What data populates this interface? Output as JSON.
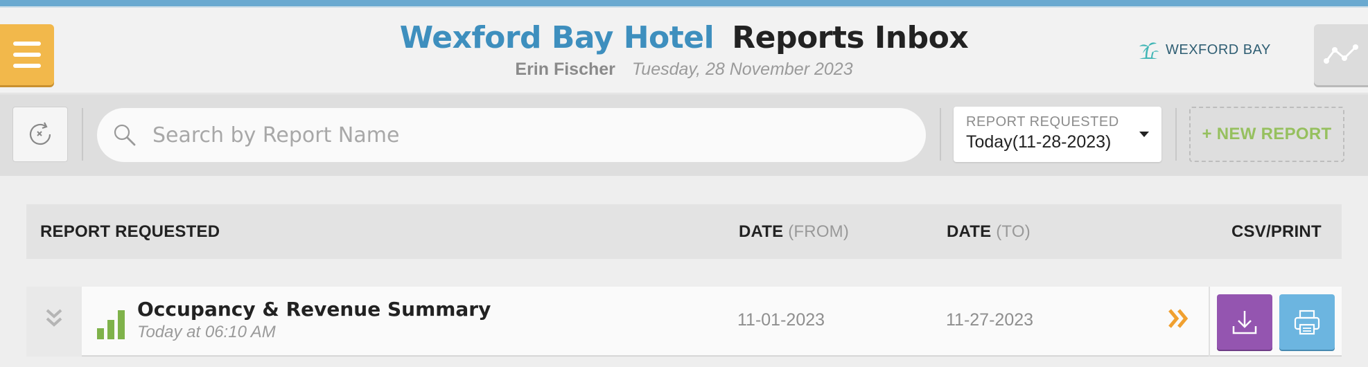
{
  "header": {
    "hotel_name": "Wexford Bay Hotel",
    "page_title": "Reports Inbox",
    "user_name": "Erin Fischer",
    "date": "Tuesday, 28 November 2023",
    "brand_text": "WEXFORD BAY",
    "brand_icon": "palm-island-icon",
    "menu_icon": "hamburger-menu-icon",
    "graph_icon": "line-graph-icon"
  },
  "toolbar": {
    "reset_icon": "reset-filters-icon",
    "search_placeholder": "Search by Report Name",
    "search_value": "",
    "filter_label": "REPORT REQUESTED",
    "filter_value": "Today(11-28-2023)",
    "new_report_label": "+ NEW REPORT"
  },
  "table": {
    "columns": {
      "report": "REPORT REQUESTED",
      "date_from_main": "DATE",
      "date_from_qual": "(FROM)",
      "date_to_main": "DATE",
      "date_to_qual": "(TO)",
      "actions": "CSV/PRINT"
    },
    "rows": [
      {
        "name": "Occupancy & Revenue Summary",
        "requested": "Today at 06:10 AM",
        "date_from": "11-01-2023",
        "date_to": "11-27-2023",
        "type_icon": "bar-chart-icon"
      }
    ]
  },
  "colors": {
    "accent_blue": "#3e8fbe",
    "menu_orange": "#f2b84b",
    "new_report_green": "#96c05f",
    "csv_purple": "#9455b0",
    "print_blue": "#6cb5e0",
    "arrow_orange": "#f0a030",
    "chart_green": "#7fb24a"
  }
}
